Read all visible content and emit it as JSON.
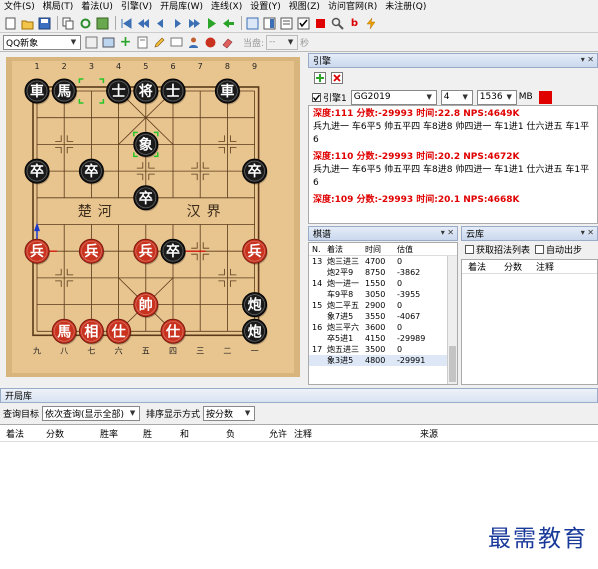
{
  "menu": [
    "文件(S)",
    "棋局(T)",
    "着法(U)",
    "引擎(V)",
    "开局库(W)",
    "连线(X)",
    "设置(Y)",
    "视图(Z)",
    "访问官网(R)",
    "未注册(Q)"
  ],
  "toolbar2": {
    "mode": "QQ新象",
    "current_label": "当盘:",
    "current_value": "--",
    "seconds_label": "秒"
  },
  "board": {
    "top_numbers": [
      "1",
      "2",
      "3",
      "4",
      "5",
      "6",
      "7",
      "8",
      "9"
    ],
    "bottom_numbers": [
      "九",
      "八",
      "七",
      "六",
      "五",
      "四",
      "三",
      "二",
      "一"
    ],
    "river_left": "楚河",
    "river_right": "汉界",
    "pieces": [
      {
        "char": "車",
        "color": "black",
        "file": 0,
        "rank": 0
      },
      {
        "char": "馬",
        "color": "black",
        "file": 1,
        "rank": 0
      },
      {
        "char": "士",
        "color": "black",
        "file": 3,
        "rank": 0
      },
      {
        "char": "将",
        "color": "black",
        "file": 4,
        "rank": 0
      },
      {
        "char": "士",
        "color": "black",
        "file": 5,
        "rank": 0
      },
      {
        "char": "車",
        "color": "black",
        "file": 7,
        "rank": 0
      },
      {
        "char": "象",
        "color": "black",
        "file": 4,
        "rank": 2
      },
      {
        "char": "卒",
        "color": "black",
        "file": 0,
        "rank": 3
      },
      {
        "char": "卒",
        "color": "black",
        "file": 2,
        "rank": 3
      },
      {
        "char": "卒",
        "color": "black",
        "file": 8,
        "rank": 3
      },
      {
        "char": "卒",
        "color": "black",
        "file": 4,
        "rank": 4
      },
      {
        "char": "兵",
        "color": "red",
        "file": 0,
        "rank": 6
      },
      {
        "char": "兵",
        "color": "red",
        "file": 2,
        "rank": 6
      },
      {
        "char": "兵",
        "color": "red",
        "file": 4,
        "rank": 6
      },
      {
        "char": "卒",
        "color": "black",
        "file": 5,
        "rank": 6
      },
      {
        "char": "兵",
        "color": "red",
        "file": 8,
        "rank": 6
      },
      {
        "char": "炮",
        "color": "black",
        "file": 8,
        "rank": 8
      },
      {
        "char": "帥",
        "color": "red",
        "file": 4,
        "rank": 8
      },
      {
        "char": "馬",
        "color": "red",
        "file": 1,
        "rank": 9
      },
      {
        "char": "相",
        "color": "red",
        "file": 2,
        "rank": 9
      },
      {
        "char": "仕",
        "color": "red",
        "file": 3,
        "rank": 9
      },
      {
        "char": "仕",
        "color": "red",
        "file": 5,
        "rank": 9
      },
      {
        "char": "炮",
        "color": "black",
        "file": 8,
        "rank": 9
      }
    ]
  },
  "engine": {
    "title": "引擎",
    "check_label": "引擎1",
    "engine_name": "GG2019",
    "threads": "4",
    "hash": "1536",
    "hash_unit": "MB",
    "lines": [
      {
        "header": "深度:111  分数:-29993  时间:22.8   NPS:4649K",
        "pv": "兵九进一 车6平5 帅五平四 车8进8 帅四进一 车1进1 仕六进五 车1平6"
      },
      {
        "header": "深度:110  分数:-29993  时间:20.2   NPS:4672K",
        "pv": "兵九进一 车6平5 帅五平四 车8进8 帅四进一 车1进1 仕六进五 车1平6"
      },
      {
        "header": "深度:109  分数:-29993  时间:20.1   NPS:4668K",
        "pv": ""
      }
    ]
  },
  "notation": {
    "title": "棋谱",
    "columns": [
      "N.",
      "着法",
      "时间",
      "估值"
    ],
    "rows": [
      {
        "n": "13",
        "move": "炮三进三",
        "time": "4700",
        "eval": "0"
      },
      {
        "n": "",
        "move": "炮2平9",
        "time": "8750",
        "eval": "-3862"
      },
      {
        "n": "14",
        "move": "炮一进一",
        "time": "1550",
        "eval": "0"
      },
      {
        "n": "",
        "move": "车9平8",
        "time": "3050",
        "eval": "-3955"
      },
      {
        "n": "15",
        "move": "炮二平五",
        "time": "2900",
        "eval": "0"
      },
      {
        "n": "",
        "move": "象7进5",
        "time": "3550",
        "eval": "-4067"
      },
      {
        "n": "16",
        "move": "炮三平六",
        "time": "3600",
        "eval": "0"
      },
      {
        "n": "",
        "move": "卒5进1",
        "time": "4150",
        "eval": "-29989"
      },
      {
        "n": "17",
        "move": "炮五进三",
        "time": "3500",
        "eval": "0"
      },
      {
        "n": "",
        "move": "象3进5",
        "time": "4800",
        "eval": "-29991"
      }
    ]
  },
  "cloud": {
    "title": "云库",
    "option1": "获取招法列表",
    "option2": "自动出步",
    "columns": [
      "着法",
      "分数",
      "注释"
    ]
  },
  "openings": {
    "title": "开局库",
    "query_label": "查询目标",
    "query_value": "依次查询(显示全部)",
    "sort_label": "排序显示方式",
    "sort_value": "按分数",
    "columns": [
      "着法",
      "分数",
      "胜率",
      "胜",
      "和",
      "负",
      "允许",
      "注释",
      "来源"
    ]
  },
  "watermark": "最需教育",
  "colors": {
    "red_piece": "#c8321e",
    "black_piece": "#1a1a1a",
    "board": "#e8c48f",
    "highlight": "#e00000",
    "accent": "#1a3a9a"
  }
}
